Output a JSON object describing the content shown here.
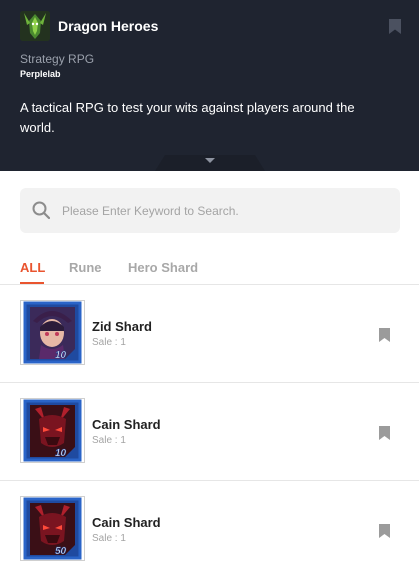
{
  "app": {
    "title": "Dragon Heroes",
    "genre": "Strategy RPG",
    "developer": "Perplelab",
    "description": "A tactical RPG to test your wits against players around the world."
  },
  "search": {
    "placeholder": "Please Enter Keyword to Search."
  },
  "tabs": [
    {
      "label": "ALL",
      "active": true
    },
    {
      "label": "Rune",
      "active": false
    },
    {
      "label": "Hero Shard",
      "active": false
    }
  ],
  "items": [
    {
      "name": "Zid Shard",
      "sale": "Sale : 1",
      "badge": "10",
      "icon": "zid-shard-icon"
    },
    {
      "name": "Cain Shard",
      "sale": "Sale : 1",
      "badge": "10",
      "icon": "cain-shard-icon"
    },
    {
      "name": "Cain Shard",
      "sale": "Sale : 1",
      "badge": "50",
      "icon": "cain-shard-icon"
    }
  ],
  "colors": {
    "header_bg": "#1f2430",
    "accent": "#e9542f",
    "bookmark": "#9b9b9b",
    "shard_blue": "#2a64c8"
  }
}
